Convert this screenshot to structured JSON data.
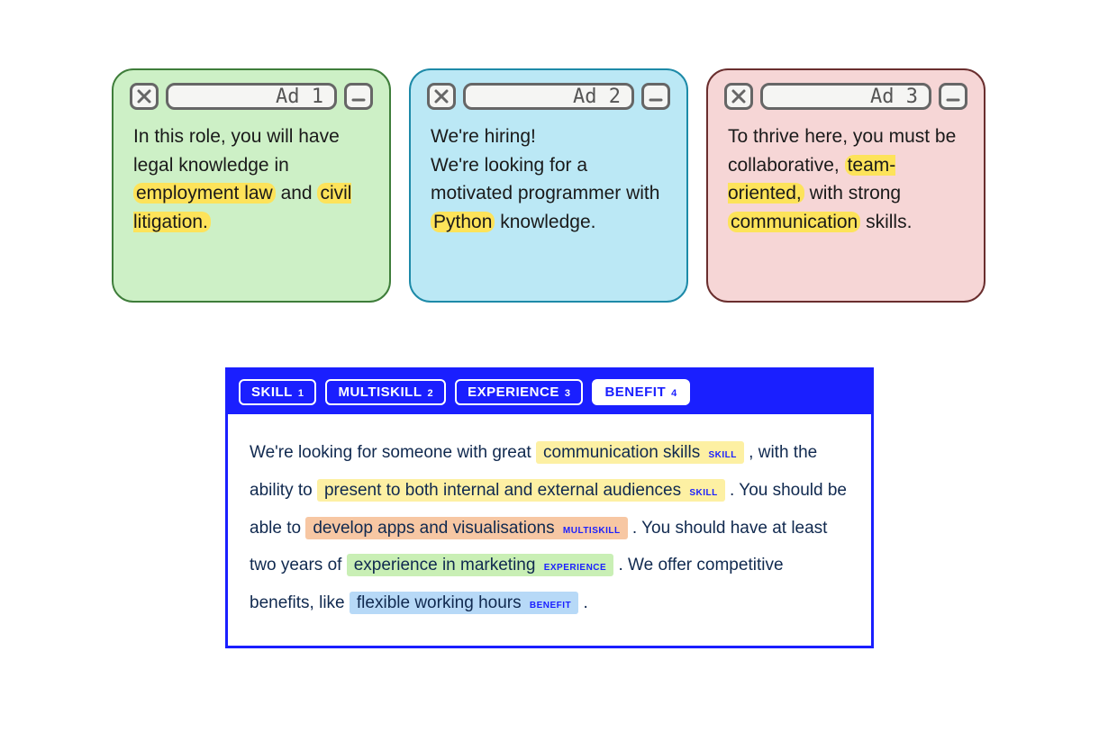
{
  "cards": [
    {
      "title": "Ad 1",
      "segments": [
        {
          "t": "In this role, you will have legal knowledge in "
        },
        {
          "t": "employment law",
          "hl": true
        },
        {
          "t": " and "
        },
        {
          "t": "civil litigation.",
          "hl": true
        }
      ]
    },
    {
      "title": "Ad 2",
      "segments": [
        {
          "t": "We're hiring!\nWe're looking for a motivated programmer with "
        },
        {
          "t": "Python",
          "hl": true
        },
        {
          "t": " knowledge."
        }
      ]
    },
    {
      "title": "Ad 3",
      "segments": [
        {
          "t": "To thrive here, you must be collaborative, "
        },
        {
          "t": "team-oriented,",
          "hl": true
        },
        {
          "t": " with strong "
        },
        {
          "t": "communication",
          "hl": true
        },
        {
          "t": " skills."
        }
      ]
    }
  ],
  "annotator": {
    "tabs": [
      {
        "label": "SKILL",
        "key": "1",
        "active": false
      },
      {
        "label": "MULTISKILL",
        "key": "2",
        "active": false
      },
      {
        "label": "EXPERIENCE",
        "key": "3",
        "active": false
      },
      {
        "label": "BENEFIT",
        "key": "4",
        "active": true
      }
    ],
    "segments": [
      {
        "t": "We're looking for someone with great "
      },
      {
        "t": "communication skills",
        "ent": "SKILL"
      },
      {
        "t": " , with the ability to "
      },
      {
        "t": "present to both internal and external audiences",
        "ent": "SKILL"
      },
      {
        "t": " . You should be able to "
      },
      {
        "t": "develop apps and visualisations",
        "ent": "MULTISKILL"
      },
      {
        "t": " . You should have at least two years of "
      },
      {
        "t": "experience in marketing",
        "ent": "EXPERIENCE"
      },
      {
        "t": " . We offer competitive benefits, like "
      },
      {
        "t": "flexible working hours",
        "ent": "BENEFIT"
      },
      {
        "t": " ."
      }
    ]
  },
  "entClass": {
    "SKILL": "ent-skill",
    "MULTISKILL": "ent-multiskill",
    "EXPERIENCE": "ent-experience",
    "BENEFIT": "ent-benefit"
  }
}
